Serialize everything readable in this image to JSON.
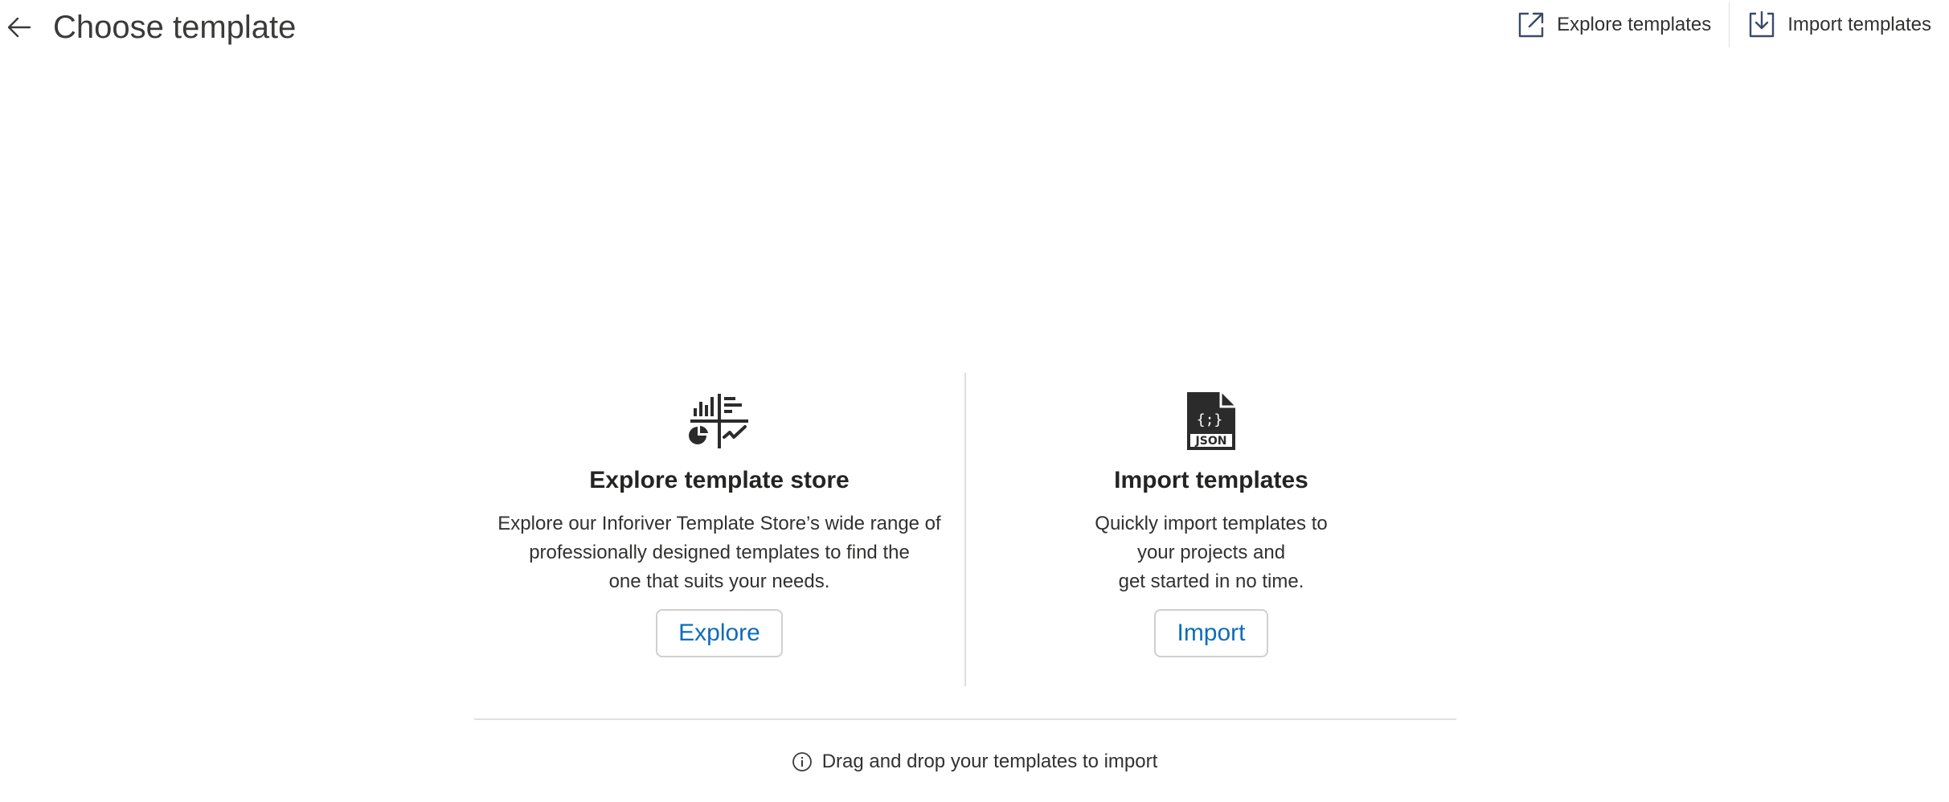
{
  "header": {
    "title": "Choose template",
    "actions": {
      "explore_label": "Explore templates",
      "import_label": "Import templates"
    }
  },
  "explore_card": {
    "heading": "Explore template store",
    "description_lines": [
      "Explore our Inforiver Template Store’s wide range of",
      "professionally designed templates to find the",
      "one that suits your needs."
    ],
    "button_label": "Explore"
  },
  "import_card": {
    "heading": "Import templates",
    "description_lines": [
      "Quickly import templates to",
      "your projects and",
      "get started in no time."
    ],
    "button_label": "Import",
    "icon_text_top": "{;}",
    "icon_text_bottom": "JSON"
  },
  "footer": {
    "hint": "Drag and drop your templates to import"
  },
  "icons": {
    "back": "arrow-left-icon",
    "explore": "external-link-icon",
    "import": "download-tray-icon",
    "store": "template-store-icon",
    "json": "json-file-icon",
    "info": "info-icon"
  },
  "colors": {
    "accent": "#0f6cbd",
    "text": "#252423",
    "divider": "#e1dfdd",
    "icon_dark": "#2b2b2b"
  }
}
